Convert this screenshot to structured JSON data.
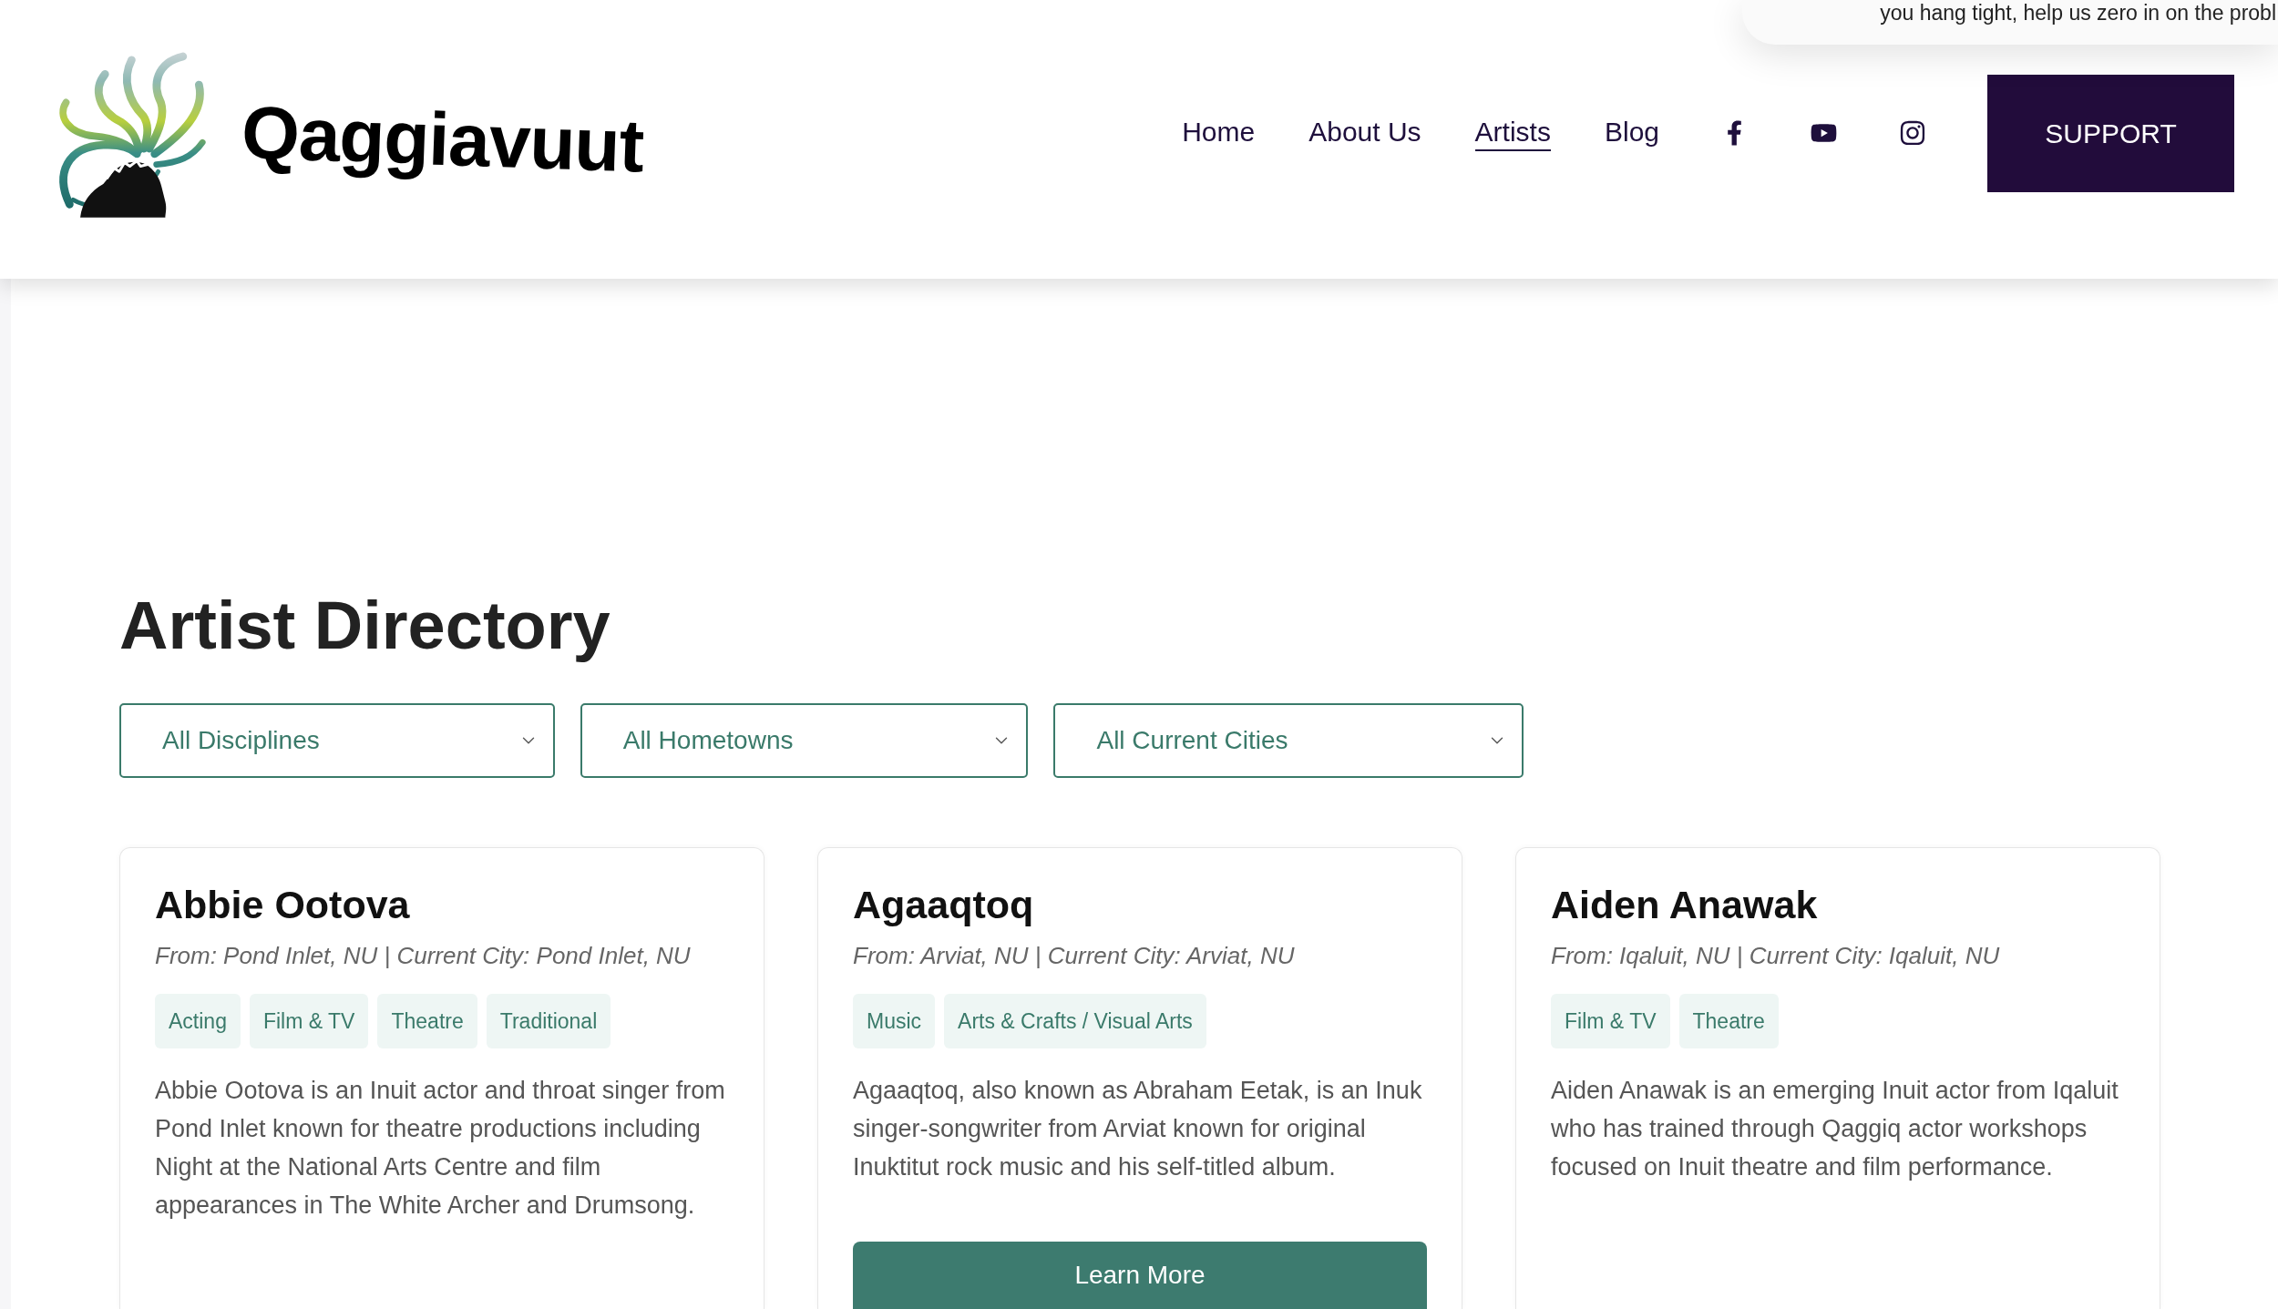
{
  "notice": {
    "text": "you hang tight, help us zero in on the probl"
  },
  "header": {
    "site_name": "Qaggiavuut",
    "nav": [
      {
        "label": "Home",
        "selected": false
      },
      {
        "label": "About Us",
        "selected": false
      },
      {
        "label": "Artists",
        "selected": true
      },
      {
        "label": "Blog",
        "selected": false
      }
    ],
    "social": [
      {
        "kind": "facebook"
      },
      {
        "kind": "youtube"
      },
      {
        "kind": "instagram"
      }
    ],
    "support_button": "SUPPORT"
  },
  "directory": {
    "title": "Artist Directory",
    "filters": [
      {
        "value": "All Disciplines"
      },
      {
        "value": "All Hometowns"
      },
      {
        "value": "All Current Cities"
      }
    ],
    "artists": [
      {
        "name": "Abbie Ootova",
        "location": "From: Pond Inlet, NU | Current City: Pond Inlet, NU",
        "tags": [
          "Acting",
          "Film & TV",
          "Theatre",
          "Traditional"
        ],
        "bio": "Abbie Ootova is an Inuit actor and throat singer from Pond Inlet known for theatre productions including Night at the National Arts Centre and film appearances in The White Archer and Drumsong."
      },
      {
        "name": "Agaaqtoq",
        "location": "From: Arviat, NU | Current City: Arviat, NU",
        "tags": [
          "Music",
          "Arts & Crafts / Visual Arts"
        ],
        "bio": "Agaaqtoq, also known as Abraham Eetak, is an Inuk singer-songwriter from Arviat known for original Inuktitut rock music and his self-titled album.",
        "button": "Learn More"
      },
      {
        "name": "Aiden Anawak",
        "location": "From: Iqaluit, NU | Current City: Iqaluit, NU",
        "tags": [
          "Film & TV",
          "Theatre"
        ],
        "bio": "Aiden Anawak is an emerging Inuit actor from Iqaluit who has trained through Qaggiq actor workshops focused on Inuit theatre and film performance."
      }
    ]
  }
}
